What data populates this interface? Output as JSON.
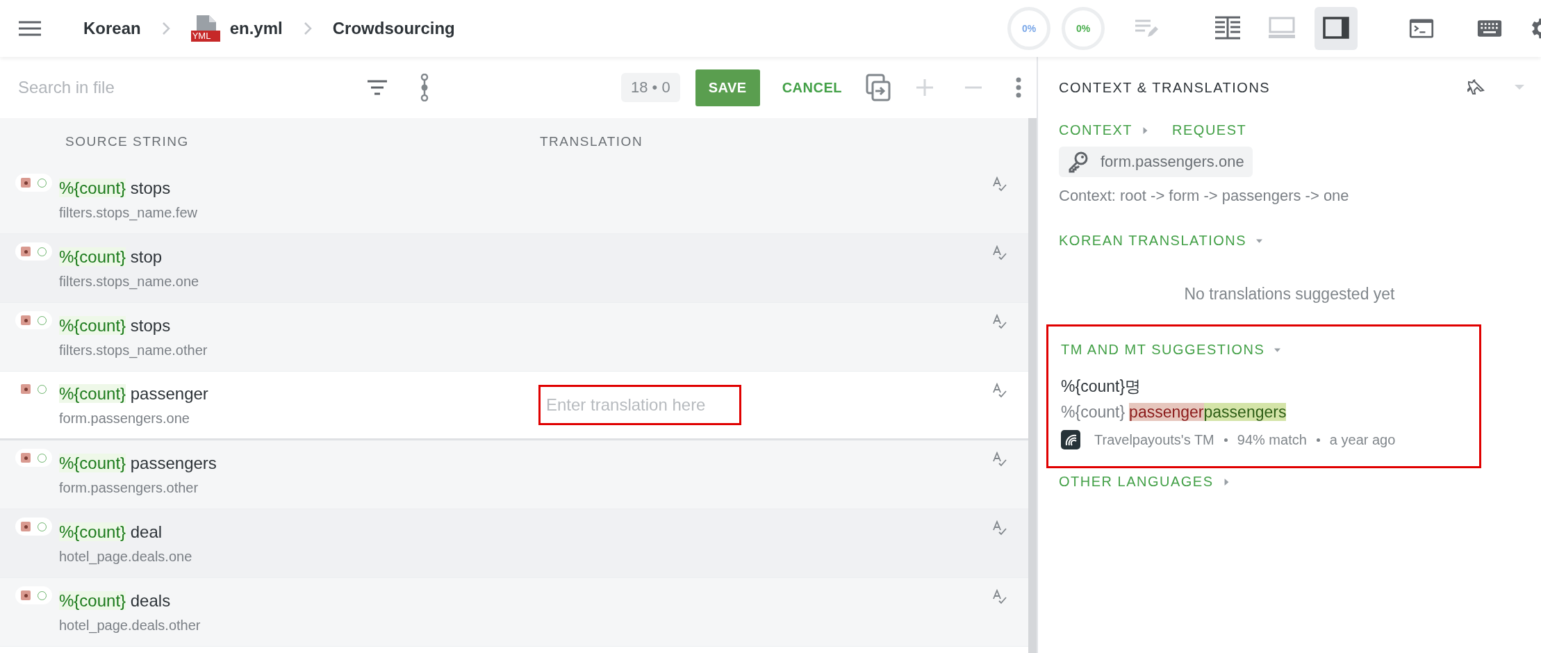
{
  "topbar": {
    "breadcrumbs": [
      {
        "label": "Korean",
        "kind": "text"
      },
      {
        "label": "en.yml",
        "kind": "file",
        "badge": "YML"
      },
      {
        "label": "Crowdsourcing",
        "kind": "text"
      }
    ],
    "progress": [
      {
        "label": "0%",
        "color": "#7aa7e8"
      },
      {
        "label": "0%",
        "color": "#4caf50"
      }
    ],
    "views": [
      {
        "kind": "side-by-side",
        "selected": false
      },
      {
        "kind": "bottom",
        "selected": false
      },
      {
        "kind": "right",
        "selected": true
      }
    ]
  },
  "toolbar": {
    "search": {
      "placeholder": "Search in file"
    },
    "counter": "18 • 0",
    "save": "SAVE",
    "cancel": "CANCEL"
  },
  "table": {
    "columns": [
      "SOURCE STRING",
      "TRANSLATION"
    ],
    "rows": [
      {
        "token": "%{count}",
        "text": "stops",
        "key": "filters.stops_name.few",
        "selected": false
      },
      {
        "token": "%{count}",
        "text": "stop",
        "key": "filters.stops_name.one",
        "selected": false
      },
      {
        "token": "%{count}",
        "text": "stops",
        "key": "filters.stops_name.other",
        "selected": false
      },
      {
        "token": "%{count}",
        "text": "passenger",
        "key": "form.passengers.one",
        "selected": true,
        "translation": {
          "placeholder": "Enter translation here",
          "highlighted": true
        }
      },
      {
        "token": "%{count}",
        "text": "passengers",
        "key": "form.passengers.other",
        "selected": false
      },
      {
        "token": "%{count}",
        "text": "deal",
        "key": "hotel_page.deals.one",
        "selected": false
      },
      {
        "token": "%{count}",
        "text": "deals",
        "key": "hotel_page.deals.other",
        "selected": false
      }
    ]
  },
  "panel": {
    "title": "CONTEXT & TRANSLATIONS",
    "context_links": [
      {
        "label": "CONTEXT",
        "expanded": false
      },
      {
        "label": "REQUEST"
      }
    ],
    "key": "form.passengers.one",
    "context_path": "Context: root -> form -> passengers -> one",
    "korean": {
      "title": "KOREAN TRANSLATIONS",
      "expanded": true,
      "empty_message": "No translations suggested yet"
    },
    "suggestions": {
      "title": "TM AND MT SUGGESTIONS",
      "expanded": true,
      "highlighted": true,
      "items": [
        {
          "translation": "%{count}명",
          "diff": [
            {
              "kind": "same",
              "text": "%{count}"
            },
            {
              "kind": "removed",
              "text": "passenger"
            },
            {
              "kind": "added",
              "text": "passengers"
            }
          ],
          "source": "Travelpayouts's TM",
          "match": "94% match",
          "time": "a year ago"
        }
      ]
    },
    "other": {
      "title": "OTHER LANGUAGES",
      "expanded": false
    }
  }
}
